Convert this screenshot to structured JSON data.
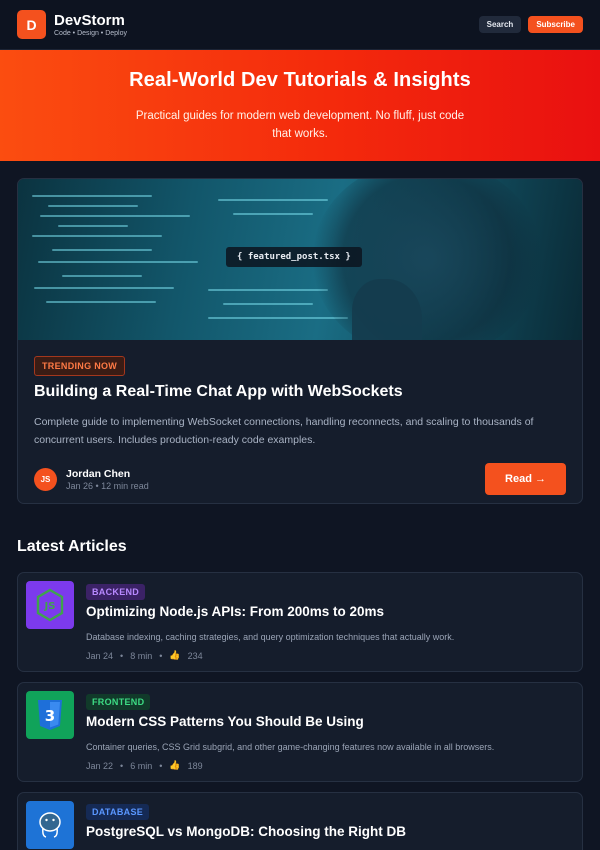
{
  "header": {
    "logo_letter": "D",
    "brand_name": "DevStorm",
    "tagline": "Code • Design • Deploy",
    "search_label": "Search",
    "subscribe_label": "Subscribe"
  },
  "hero": {
    "title": "Real-World Dev Tutorials & Insights",
    "subtitle": "Practical guides for modern web development. No fluff, just code that works."
  },
  "featured": {
    "image_label": "{ featured_post.tsx }",
    "badge": "TRENDING NOW",
    "title": "Building a Real-Time Chat App with WebSockets",
    "description": "Complete guide to implementing WebSocket connections, handling reconnects, and scaling to thousands of concurrent users. Includes production-ready code examples.",
    "author_initials": "JS",
    "author_name": "Jordan Chen",
    "meta": "Jan 26 • 12 min read",
    "read_label": "Read →"
  },
  "latest": {
    "heading": "Latest Articles",
    "articles": [
      {
        "category": "BACKEND",
        "title": "Optimizing Node.js APIs: From 200ms to 20ms",
        "description": "Database indexing, caching strategies, and query optimization techniques that actually work.",
        "date": "Jan 24",
        "read_time": "8 min",
        "likes": "234",
        "icon": "nodejs-icon"
      },
      {
        "category": "FRONTEND",
        "title": "Modern CSS Patterns You Should Be Using",
        "description": "Container queries, CSS Grid subgrid, and other game-changing features now available in all browsers.",
        "date": "Jan 22",
        "read_time": "6 min",
        "likes": "189",
        "icon": "css3-icon"
      },
      {
        "category": "DATABASE",
        "title": "PostgreSQL vs MongoDB: Choosing the Right DB",
        "icon": "postgresql-icon"
      }
    ]
  },
  "colors": {
    "accent": "#f4511e",
    "background": "#0f1523",
    "card": "#151d2c",
    "backend_badge": "#a06bff",
    "frontend_badge": "#35d07f",
    "database_badge": "#4d8bff"
  }
}
